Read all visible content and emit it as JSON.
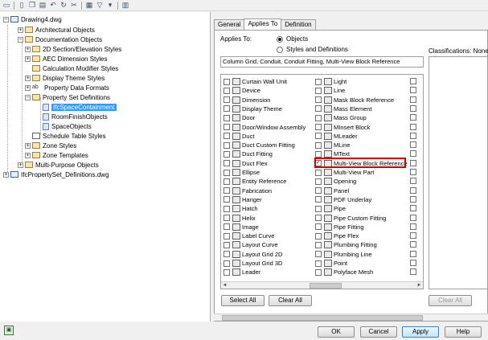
{
  "toolbar": {
    "icons": [
      "open-icon",
      "new-icon",
      "copy-icon",
      "paste-icon",
      "undo-icon",
      "refresh-icon",
      "purge-icon",
      "filter-icon",
      "dropdown-icon",
      "list-icon",
      "edit-icon"
    ]
  },
  "tree": {
    "items": [
      {
        "label": "Drawing4.dwg"
      },
      {
        "label": "Architectural Objects"
      },
      {
        "label": "Documentation Objects"
      },
      {
        "label": "2D Section/Elevation Styles"
      },
      {
        "label": "AEC Dimension Styles"
      },
      {
        "label": "Calculation Modifier Styles"
      },
      {
        "label": "Display Theme Styles"
      },
      {
        "label": "Property Data Formats"
      },
      {
        "label": "Property Set Definitions"
      },
      {
        "label": "IfcSpaceContainment"
      },
      {
        "label": "RoomFinishObjects"
      },
      {
        "label": "SpaceObjects"
      },
      {
        "label": "Schedule Table Styles"
      },
      {
        "label": "Zone Styles"
      },
      {
        "label": "Zone Templates"
      },
      {
        "label": "Multi-Purpose Objects"
      },
      {
        "label": "IfcPropertySet_Definitions.dwg"
      }
    ],
    "ab_glyph": "ab"
  },
  "tabs": [
    "General",
    "Applies To",
    "Definition"
  ],
  "applies_to": {
    "label": "Applies To:",
    "option_objects": "Objects",
    "option_styles": "Styles and Definitions",
    "text": "Column Grid, Conduit, Conduit Fitting, Multi-View Block Reference",
    "classifications_label": "Classifications: None av"
  },
  "objects": {
    "col1": [
      "Curtain Wall Unit",
      "Device",
      "Dimension",
      "Display Theme",
      "Door",
      "Door/Window Assembly",
      "Duct",
      "Duct Custom Fitting",
      "Duct Fitting",
      "Duct Flex",
      "Ellipse",
      "Entity Reference",
      "Fabrication",
      "Hanger",
      "Hatch",
      "Helix",
      "Image",
      "Label Curve",
      "Layout Curve",
      "Layout Grid 2D",
      "Layout Grid 3D",
      "Leader"
    ],
    "col2": [
      "Light",
      "Line",
      "Mask Block Reference",
      "Mass Element",
      "Mass Group",
      "MInsert Block",
      "MLeader",
      "MLine",
      "MText",
      "Multi-View Block Reference",
      "Multi-View Part",
      "Opening",
      "Panel",
      "PDF Underlay",
      "Pipe",
      "Pipe Custom Fitting",
      "Pipe Fitting",
      "Pipe Flex",
      "Plumbing Fitting",
      "Plumbing Line",
      "Point",
      "Polyface Mesh"
    ],
    "checked": "Multi-View Block Reference",
    "check_glyph": "✓"
  },
  "buttons": {
    "select_all": "Select All",
    "clear_all": "Clear All",
    "clear_all_classif": "Clear All",
    "ok": "OK",
    "cancel": "Cancel",
    "apply": "Apply",
    "help": "Help"
  },
  "scroll": {
    "left": "◄",
    "right": "►"
  },
  "colors": {
    "selection": "#3399ff",
    "highlight": "#d00000"
  }
}
